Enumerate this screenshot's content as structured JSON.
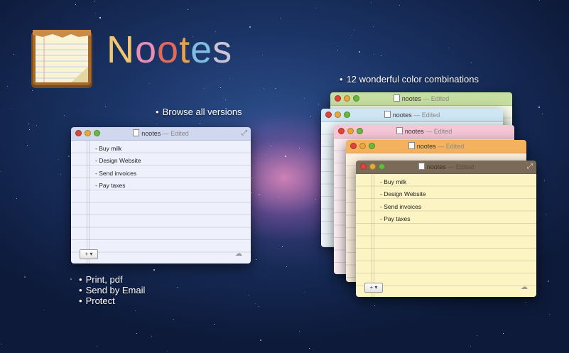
{
  "app": {
    "title_letters": [
      {
        "ch": "N",
        "color": "#f2c66e"
      },
      {
        "ch": "o",
        "color": "#e98fb4"
      },
      {
        "ch": "o",
        "color": "#e26a5a"
      },
      {
        "ch": "t",
        "color": "#e9a04c"
      },
      {
        "ch": "e",
        "color": "#7fbde3"
      },
      {
        "ch": "s",
        "color": "#c9c4d6"
      }
    ]
  },
  "features": {
    "browse": "Browse all versions",
    "colors": "12 wonderful color combinations",
    "print": "Print, pdf",
    "email": "Send by Email",
    "protect": "Protect"
  },
  "note": {
    "name": "nootes",
    "status": "— Edited",
    "items": [
      "- Buy milk",
      "- Design Website",
      "- Send invoices",
      "- Pay taxes"
    ],
    "add_glyph": "+ ▾",
    "cloud_icon": "cloud-icon"
  },
  "themes": {
    "blue": {
      "title": "#cfd8ee",
      "paper": "#eef1fb"
    },
    "green": {
      "title": "#c6dfa0",
      "paper": "#f3f8e8"
    },
    "lightblue": {
      "title": "#cfe6f5",
      "paper": "#edf6fb"
    },
    "pink": {
      "title": "#f5c6d6",
      "paper": "#fbeef2"
    },
    "orange": {
      "title": "#f4b25f",
      "paper": "#fdf1df"
    },
    "dark": {
      "title": "#7a6a58",
      "paper": "#fdf4c4"
    }
  }
}
